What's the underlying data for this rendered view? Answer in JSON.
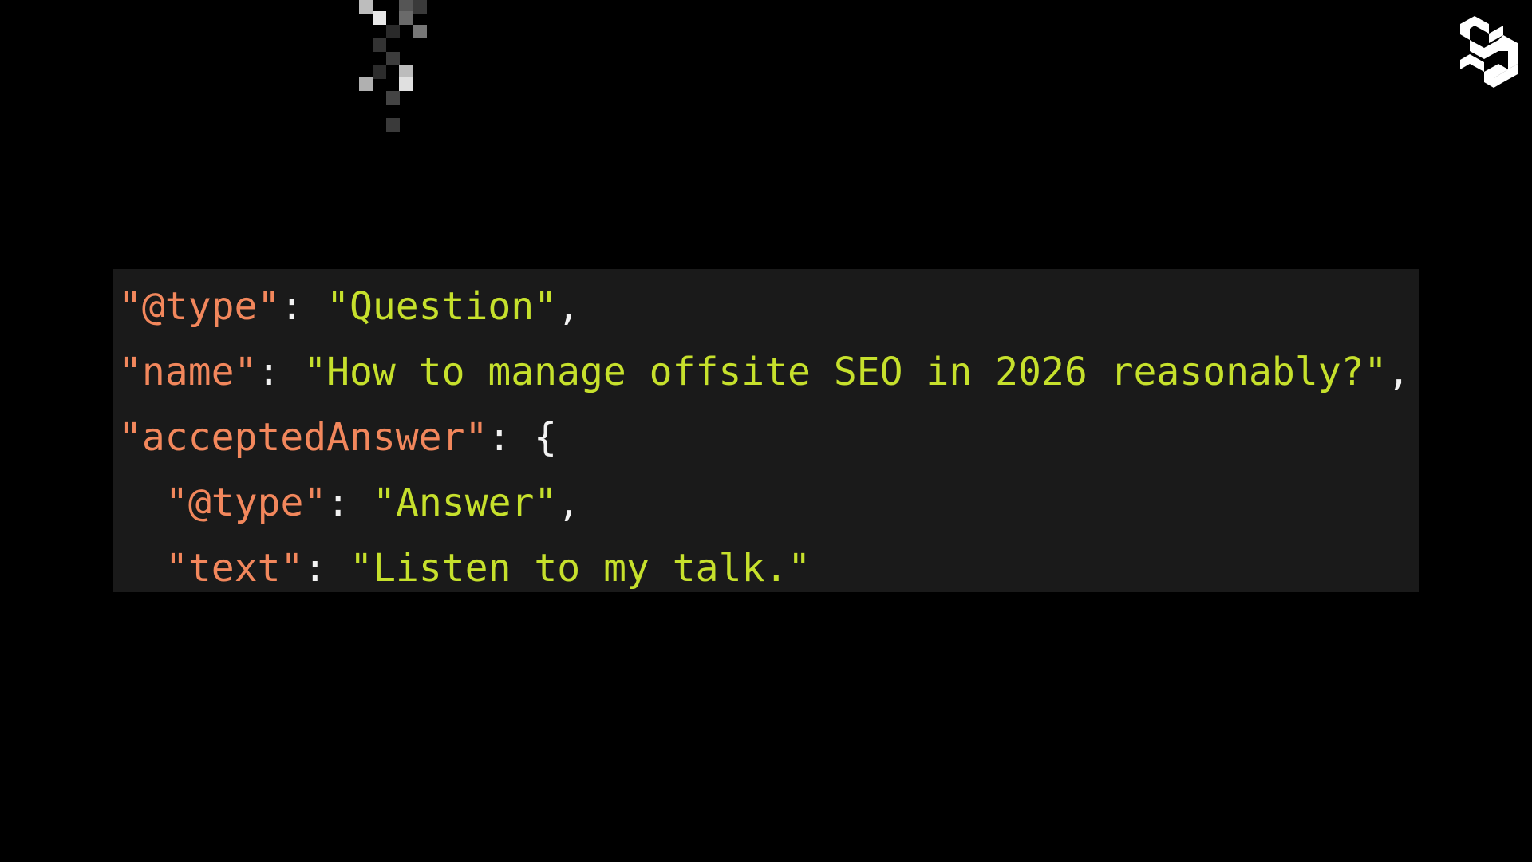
{
  "colors": {
    "background": "#000000",
    "panel": "#1a1a1a",
    "key": "#f2875c",
    "string": "#c6e02c",
    "punctuation": "#f2f2f2"
  },
  "logo_icon": "brand-logo-icon",
  "code": {
    "line1": {
      "key": "\"@type\"",
      "sep": ": ",
      "value": "\"Question\"",
      "end": ","
    },
    "line2": {
      "key": "\"name\"",
      "sep": ": ",
      "value": "\"How to manage offsite SEO in 2026 reasonably?\"",
      "end": ","
    },
    "line3": {
      "key": "\"acceptedAnswer\"",
      "sep": ": {"
    },
    "line4": {
      "key": "\"@type\"",
      "sep": ": ",
      "value": "\"Answer\"",
      "end": ","
    },
    "line5": {
      "key": "\"text\"",
      "sep": ": ",
      "value": "\"Listen to my talk.\""
    }
  }
}
